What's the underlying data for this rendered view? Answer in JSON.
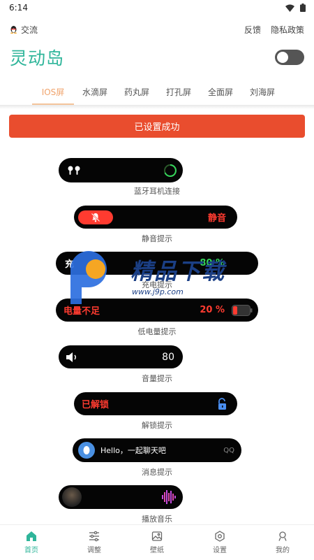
{
  "status_bar": {
    "time": "6:14"
  },
  "top": {
    "community_label": "交流",
    "feedback": "反馈",
    "privacy": "隐私政策"
  },
  "app": {
    "title": "灵动岛",
    "accent": "#2fb59a"
  },
  "tabs": [
    {
      "label": "IOS屏",
      "active": true
    },
    {
      "label": "水滴屏",
      "active": false
    },
    {
      "label": "药丸屏",
      "active": false
    },
    {
      "label": "打孔屏",
      "active": false
    },
    {
      "label": "全面屏",
      "active": false
    },
    {
      "label": "刘海屏",
      "active": false
    }
  ],
  "status_button": {
    "label": "已设置成功",
    "color": "#e94d2e"
  },
  "previews": {
    "bluetooth": {
      "caption": "蓝牙耳机连接"
    },
    "mute": {
      "label": "静音",
      "caption": "静音提示"
    },
    "charging": {
      "label": "充",
      "value": "80 %",
      "caption": "充电提示"
    },
    "low_battery": {
      "label": "电量不足",
      "value": "20 %",
      "caption": "低电量提示"
    },
    "volume": {
      "value": "80",
      "caption": "音量提示"
    },
    "unlock": {
      "label": "已解锁",
      "caption": "解锁提示"
    },
    "message": {
      "text": "Hello，一起聊天吧",
      "source": "QQ",
      "caption": "消息提示"
    },
    "music": {
      "caption": "播放音乐"
    }
  },
  "watermark": {
    "text": "精品下载",
    "url": "www.j9p.com"
  },
  "bottom_nav": [
    {
      "label": "首页",
      "icon": "home-icon",
      "active": true
    },
    {
      "label": "调整",
      "icon": "sliders-icon",
      "active": false
    },
    {
      "label": "壁纸",
      "icon": "image-icon",
      "active": false
    },
    {
      "label": "设置",
      "icon": "gear-icon",
      "active": false
    },
    {
      "label": "我的",
      "icon": "user-icon",
      "active": false
    }
  ]
}
